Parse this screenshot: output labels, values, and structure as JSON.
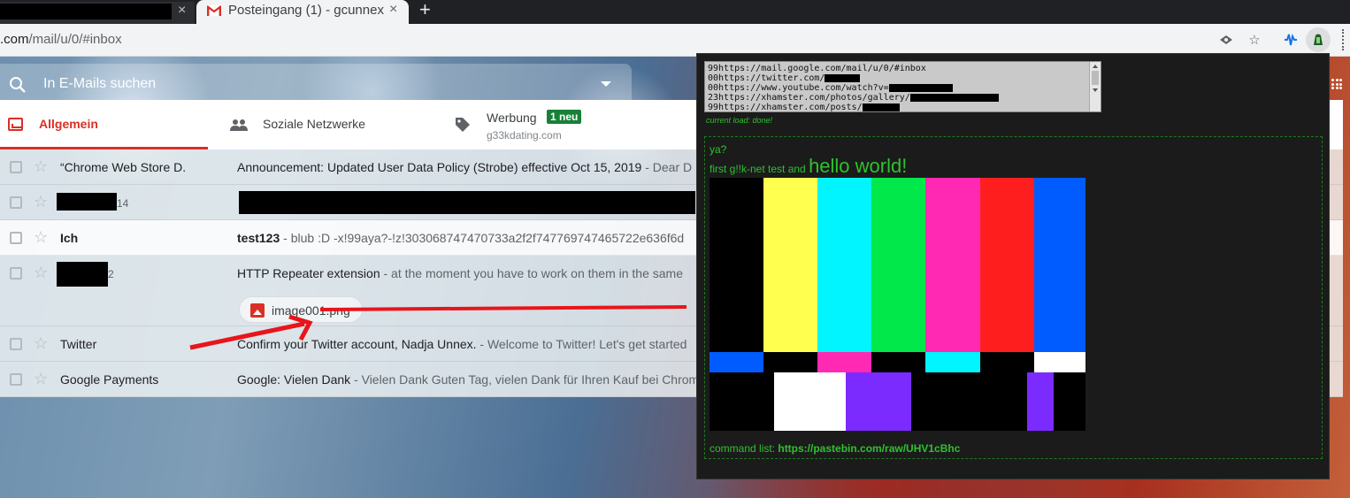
{
  "browser": {
    "active_tab_title": "Posteingang (1) - gcunnex",
    "new_tab_glyph": "+",
    "close_glyph": "×",
    "url_host": ".com",
    "url_path": "/mail/u/0/#inbox"
  },
  "gmail": {
    "search_placeholder": "In E-Mails suchen",
    "tabs": {
      "primary": "Allgemein",
      "social": "Soziale Netzwerke",
      "promotions": "Werbung",
      "promotions_badge": "1 neu",
      "promotions_sub": "g33kdating.com"
    },
    "rows": [
      {
        "sender": "“Chrome Web Store D.",
        "subject": "Announcement: Updated User Data Policy (Strobe) effective Oct 15, 2019",
        "snippet": " - Dear D",
        "unread": false
      },
      {
        "sender": "",
        "count": "14",
        "subject": "",
        "snippet": "",
        "unread": false
      },
      {
        "sender": "Ich",
        "subject": "test123",
        "snippet": " - blub :D -x!99aya?-!z!303068747470733a2f2f747769747465722e636f6d",
        "unread": true
      },
      {
        "sender": "",
        "count": "2",
        "subject": "HTTP Repeater extension",
        "snippet": " - at the moment you have to work on them in the same",
        "unread": false,
        "attachment": "image001.png"
      },
      {
        "sender": "Twitter",
        "subject": "Confirm your Twitter account, Nadja Unnex.",
        "snippet": " - Welcome to Twitter! Let's get started",
        "unread": false
      },
      {
        "sender": "Google Payments",
        "subject": "Google: Vielen Dank",
        "snippet": " - Vielen Dank Guten Tag, vielen Dank für Ihren Kauf bei Chrom",
        "unread": false
      }
    ]
  },
  "popup": {
    "log": [
      "99https://mail.google.com/mail/u/0/#inbox",
      "00https://twitter.com/",
      "00https://www.youtube.com/watch?v=",
      "23https://xhamster.com/photos/gallery/",
      "99https://xhamster.com/posts/"
    ],
    "load_status": "current load: done!",
    "greeting": "ya?",
    "line_small": "first g!!k-net test and ",
    "line_big": "hello world!",
    "cmd_label": "command list: ",
    "cmd_link": "https://pastebin.com/raw/UHV1cBhc"
  },
  "colors": {
    "gmail_red": "#d93025",
    "terminal_green": "#2ec22e",
    "badge_green": "#188038"
  }
}
